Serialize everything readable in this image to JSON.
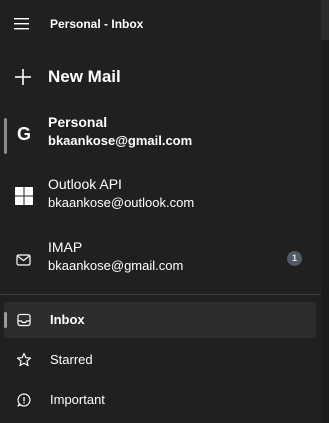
{
  "header": {
    "title": "Personal - Inbox",
    "menu_icon": "hamburger-menu-icon"
  },
  "new_mail": {
    "label": "New Mail",
    "icon": "plus-icon"
  },
  "accounts": [
    {
      "name": "Personal",
      "email": "bkaankose@gmail.com",
      "icon": "google-icon",
      "selected": true,
      "unread": null
    },
    {
      "name": "Outlook API",
      "email": "bkaankose@outlook.com",
      "icon": "windows-icon",
      "selected": false,
      "unread": null
    },
    {
      "name": "IMAP",
      "email": "bkaankose@gmail.com",
      "icon": "envelope-icon",
      "selected": false,
      "unread": "1"
    }
  ],
  "folders": [
    {
      "label": "Inbox",
      "icon": "inbox-icon",
      "selected": true
    },
    {
      "label": "Starred",
      "icon": "star-icon",
      "selected": false
    },
    {
      "label": "Important",
      "icon": "important-icon",
      "selected": false
    }
  ],
  "colors": {
    "background": "#202020",
    "selected_folder_bg": "#2d2d2d",
    "badge_bg": "#4f5a66",
    "text": "#ffffff"
  }
}
